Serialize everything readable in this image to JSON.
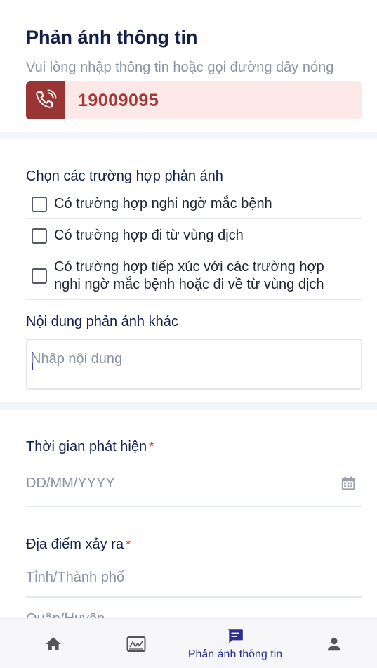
{
  "header": {
    "title": "Phản ánh thông tin",
    "subtitle": "Vui lòng nhập thông tin hoặc gọi đường dây nóng"
  },
  "hotline": {
    "icon": "phone-icon",
    "number": "19009095"
  },
  "cases": {
    "title": "Chọn các trường hợp phản ánh",
    "options": [
      {
        "label": "Có trường hợp nghi ngờ mắc bệnh",
        "checked": false
      },
      {
        "label": "Có trường hợp đi từ vùng dịch",
        "checked": false
      },
      {
        "label_line1": "Có trường hợp tiếp xúc với các trường hợp",
        "label_line2": "nghi ngờ mắc bệnh hoặc đi về từ vùng dịch",
        "checked": false
      }
    ]
  },
  "other": {
    "label": "Nội dung phản ánh khác",
    "placeholder": "Nhập nội dung"
  },
  "detect_time": {
    "label": "Thời gian phát hiện",
    "required_mark": "*",
    "placeholder": "DD/MM/YYYY",
    "icon": "calendar-icon"
  },
  "location": {
    "label": "Địa điểm xảy ra",
    "required_mark": "*",
    "province_placeholder": "Tỉnh/Thành phố",
    "district_placeholder": "Quận/Huyện"
  },
  "tabbar": {
    "active_color": "#2b2f8c",
    "inactive_color": "#555555",
    "items": [
      {
        "icon": "home-icon",
        "label": ""
      },
      {
        "icon": "chart-icon",
        "label": ""
      },
      {
        "icon": "chat-icon",
        "label": "Phản ánh thông tin",
        "active": true
      },
      {
        "icon": "person-icon",
        "label": ""
      }
    ]
  }
}
